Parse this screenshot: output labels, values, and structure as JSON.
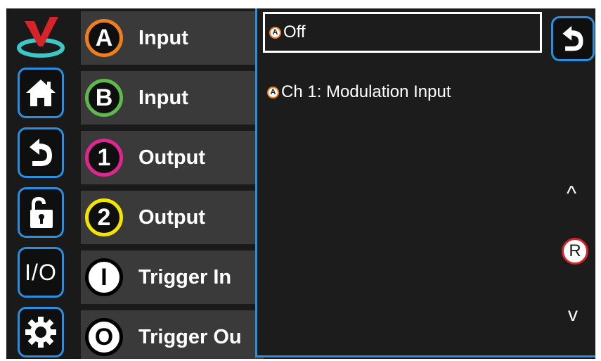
{
  "sidebar": {
    "io_label": "I/O"
  },
  "rows": [
    {
      "badge": "A",
      "label": "Input",
      "color": "#f07d1e"
    },
    {
      "badge": "B",
      "label": "Input",
      "color": "#5fb84b"
    },
    {
      "badge": "1",
      "label": "Output",
      "color": "#e0268f"
    },
    {
      "badge": "2",
      "label": "Output",
      "color": "#f3e500"
    },
    {
      "badge": "I",
      "label": "Trigger In",
      "color": "#000000"
    },
    {
      "badge": "O",
      "label": "Trigger Ou",
      "color": "#000000"
    }
  ],
  "panel": {
    "options": [
      {
        "badge": "A",
        "label": "Off",
        "selected": true
      },
      {
        "badge": "A",
        "label": "Ch 1: Modulation Input",
        "selected": false
      }
    ],
    "scroll_up": "^",
    "scroll_down": "v",
    "r_label": "R"
  },
  "colors": {
    "accent": "#2a8fe0",
    "background": "#1a1a1a",
    "row_bg": "#3a3a3a",
    "reset": "#d9232a"
  }
}
